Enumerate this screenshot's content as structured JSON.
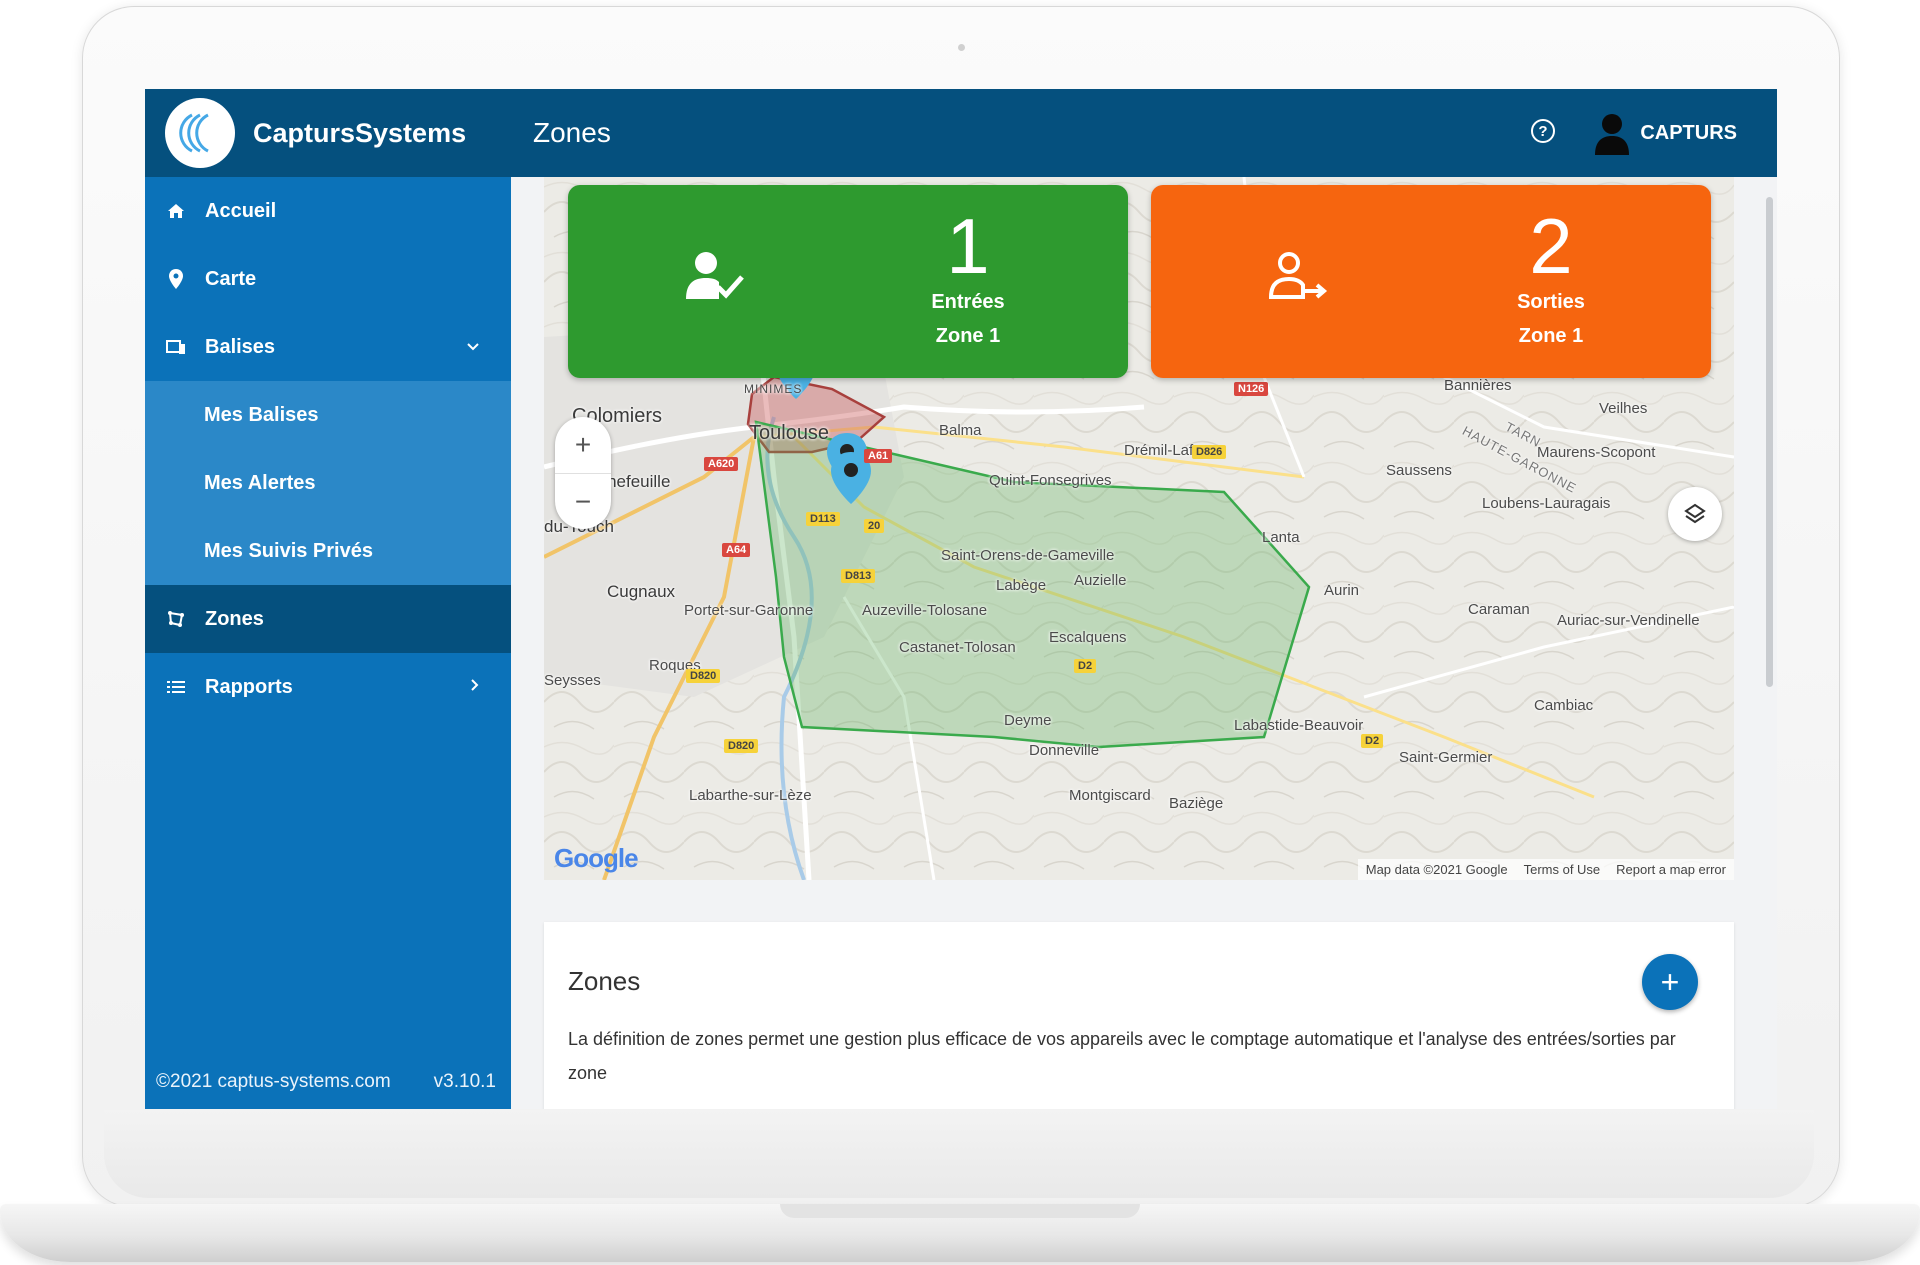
{
  "app": {
    "brand_name": "CaptursSystems",
    "page_title": "Zones",
    "user_name": "CAPTURS",
    "help_glyph": "?"
  },
  "sidebar": {
    "items": [
      {
        "label": "Accueil",
        "icon": "home-icon"
      },
      {
        "label": "Carte",
        "icon": "map-pin-icon"
      },
      {
        "label": "Balises",
        "icon": "devices-icon",
        "expanded": true
      },
      {
        "label": "Mes Balises"
      },
      {
        "label": "Mes Alertes"
      },
      {
        "label": "Mes Suivis Privés"
      },
      {
        "label": "Zones",
        "icon": "zones-icon",
        "active": true
      },
      {
        "label": "Rapports",
        "icon": "list-icon"
      }
    ],
    "footer_copyright": "©2021 captus-systems.com",
    "footer_version": "v3.10.1"
  },
  "cards": {
    "entries": {
      "count": "1",
      "label": "Entrées",
      "zone": "Zone 1",
      "color": "#2e9a2f"
    },
    "exits": {
      "count": "2",
      "label": "Sorties",
      "zone": "Zone 1",
      "color": "#f6650f"
    }
  },
  "map": {
    "zoom_in": "+",
    "zoom_out": "−",
    "google": "Google",
    "attribution": {
      "data": "Map data ©2021 Google",
      "terms": "Terms of Use",
      "report": "Report a map error"
    },
    "places": {
      "colomiers": "Colomiers",
      "toulouse": "Toulouse",
      "balma": "Balma",
      "minimes": "MINIMES",
      "drémil": "Drémil-Lafage",
      "quint": "Quint-Fonsegrives",
      "tournefeuille": "Tournefeuille",
      "dutouch": "du-Touch",
      "saint_orens": "Saint-Orens-de-Gameville",
      "auzielle": "Auzielle",
      "labege": "Labège",
      "cugnaux": "Cugnaux",
      "portet": "Portet-sur-Garonne",
      "auzeville": "Auzeville-Tolosane",
      "castanet": "Castanet-Tolosan",
      "escalquens": "Escalquens",
      "roques": "Roques",
      "seysses": "Seysses",
      "deyme": "Deyme",
      "donneville": "Donneville",
      "labarthe": "Labarthe-sur-Lèze",
      "montgiscard": "Montgiscard",
      "baziege": "Baziège",
      "labastide": "Labastide-Beauvoir",
      "saint_germier": "Saint-Germier",
      "cambiac": "Cambiac",
      "caraman": "Caraman",
      "auriac": "Auriac-sur-Vendinelle",
      "aurin": "Aurin",
      "lanta": "Lanta",
      "loubens": "Loubens-Lauragais",
      "saussens": "Saussens",
      "maurens": "Maurens-Scopont",
      "veilhes": "Veilhes",
      "bannieres": "Bannières",
      "tarn": "TARN",
      "haute_garonne": "HAUTE-GARONNE"
    },
    "roads": {
      "a620": "A620",
      "a61": "A61",
      "a64": "A64",
      "d113": "D113",
      "d813": "D813",
      "d820a": "D820",
      "d820b": "D820",
      "d2a": "D2",
      "d2b": "D2",
      "n126": "N126",
      "d826": "D826",
      "a20": "20"
    },
    "zone_colors": {
      "red_zone": "#b94a4a",
      "green_zone": "#37a84a"
    }
  },
  "zones_panel": {
    "title": "Zones",
    "add_label": "+",
    "description": "La définition de zones permet une gestion plus efficace de vos appareils avec le comptage automatique et l'analyse des entrées/sorties par zone"
  }
}
